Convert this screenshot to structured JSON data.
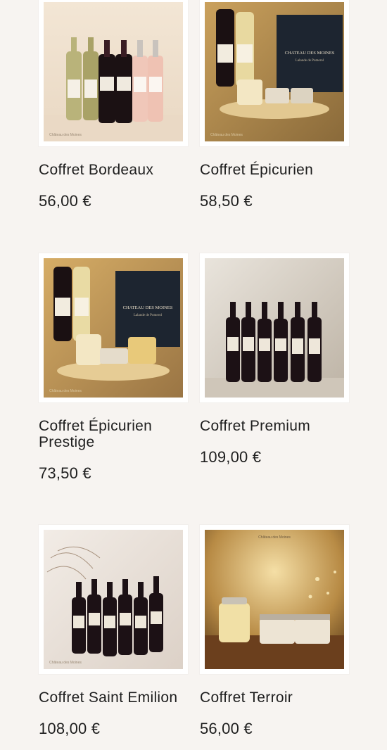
{
  "products": [
    {
      "name": "Coffret Bordeaux",
      "price": "56,00 €",
      "image_alt": "Coffret Bordeaux bottles",
      "watermark": "Château des Moines"
    },
    {
      "name": "Coffret Épicurien",
      "price": "58,50 €",
      "image_alt": "Coffret Épicurien box",
      "box_brand": "CHATEAU DES MOINES",
      "box_sub": "Lalande de Pomerol",
      "watermark": "Château des Moines"
    },
    {
      "name": "Coffret Épicurien Prestige",
      "price": "73,50 €",
      "image_alt": "Coffret Épicurien Prestige box",
      "box_brand": "CHATEAU DES MOINES",
      "box_sub": "Lalande de Pomerol",
      "watermark": "Château des Moines"
    },
    {
      "name": "Coffret Premium",
      "price": "109,00 €",
      "image_alt": "Coffret Premium bottles"
    },
    {
      "name": "Coffret Saint Emilion",
      "price": "108,00 €",
      "image_alt": "Coffret Saint Emilion bottles",
      "watermark": "Château des Moines"
    },
    {
      "name": "Coffret Terroir",
      "price": "56,00 €",
      "image_alt": "Coffret Terroir jars",
      "watermark": "Château des Moines"
    }
  ]
}
